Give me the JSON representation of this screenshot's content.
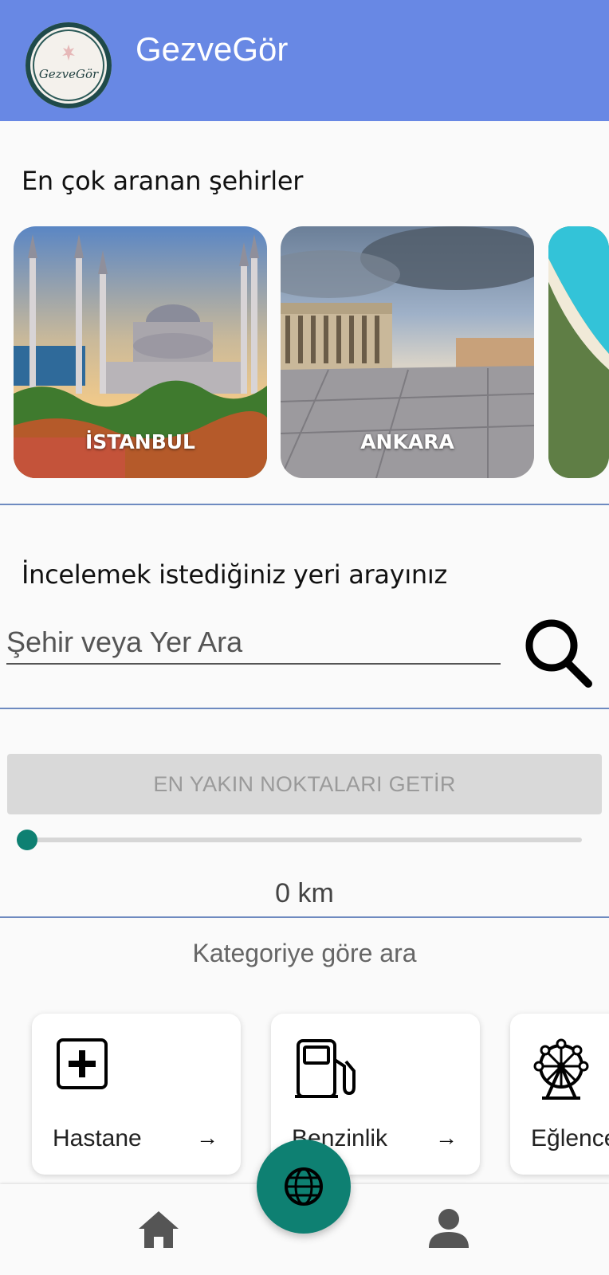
{
  "app": {
    "title": "GezveGör",
    "logo_text": "GezveGör"
  },
  "popular": {
    "heading": "En çok aranan şehirler",
    "cities": [
      {
        "name": "İSTANBUL"
      },
      {
        "name": "ANKARA"
      }
    ]
  },
  "search": {
    "heading": "İncelemek istediğiniz yeri arayınız",
    "placeholder": "Şehir veya Yer Ara",
    "value": ""
  },
  "nearest": {
    "button_label": "EN YAKIN NOKTALARI GETİR",
    "slider_value": 0,
    "distance_text": "0 km"
  },
  "categories": {
    "heading": "Kategoriye göre ara",
    "items": [
      {
        "label": "Hastane",
        "icon": "hospital-icon"
      },
      {
        "label": "Benzinlik",
        "icon": "fuel-pump-icon"
      },
      {
        "label": "Eğlence",
        "icon": "ferris-wheel-icon"
      }
    ]
  },
  "colors": {
    "appbar": "#6888e4",
    "accent": "#0e8072",
    "divider": "#6e8ac0"
  },
  "bottom_nav": {
    "items": [
      "home-icon",
      "globe-icon",
      "person-icon"
    ]
  }
}
